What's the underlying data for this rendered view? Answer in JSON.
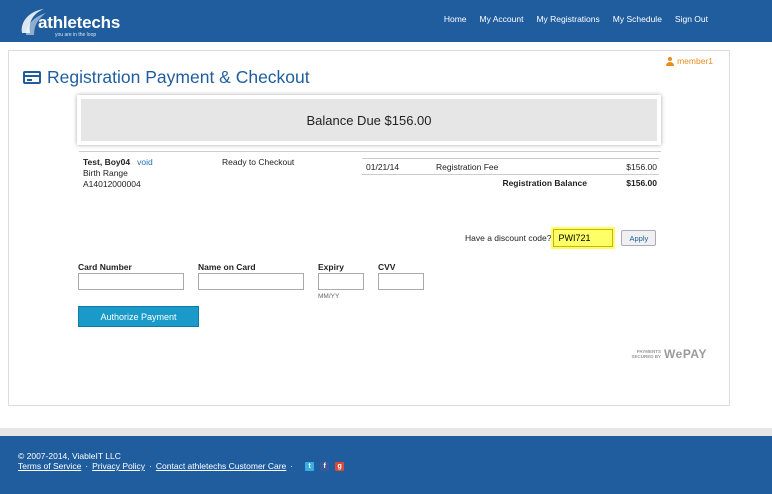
{
  "header": {
    "brand": "athletechs",
    "tagline": "you are in the loop",
    "nav": [
      "Home",
      "My Account",
      "My Registrations",
      "My Schedule",
      "Sign Out"
    ]
  },
  "user": {
    "name": "member1",
    "icon": "user-icon"
  },
  "page": {
    "title": "Registration Payment & Checkout",
    "title_icon": "credit-card-icon",
    "balance_due": "Balance Due $156.00"
  },
  "registrant": {
    "name": "Test, Boy04",
    "void_link": "void",
    "birth_range": "Birth Range",
    "id": "A14012000004",
    "status": "Ready to Checkout"
  },
  "fees": {
    "rows": [
      {
        "date": "01/21/14",
        "label": "Registration Fee",
        "amount": "$156.00"
      }
    ],
    "total_label": "Registration Balance",
    "total_amount": "$156.00"
  },
  "discount": {
    "label": "Have a discount code?",
    "value": "PWI721",
    "apply_label": "Apply",
    "highlight_color": "#ffff66"
  },
  "payment": {
    "card_number_label": "Card Number",
    "name_on_card_label": "Name on Card",
    "expiry_label": "Expiry",
    "expiry_hint": "MM/YY",
    "cvv_label": "CVV",
    "authorize_label": "Authorize Payment"
  },
  "wepay": {
    "line1": "PAYMENTS",
    "line2": "SECURED BY",
    "brand": "WePAY"
  },
  "footer": {
    "copyright": "© 2007-2014, ViableIT LLC",
    "links": [
      "Terms of Service",
      "Privacy Policy",
      "Contact athletechs Customer Care"
    ],
    "social_icons": [
      "twitter-icon",
      "facebook-icon",
      "google-plus-icon"
    ]
  },
  "colors": {
    "brand_blue": "#1f5d9e",
    "button_blue": "#1a9ac9",
    "member_orange": "#e88d1a"
  }
}
